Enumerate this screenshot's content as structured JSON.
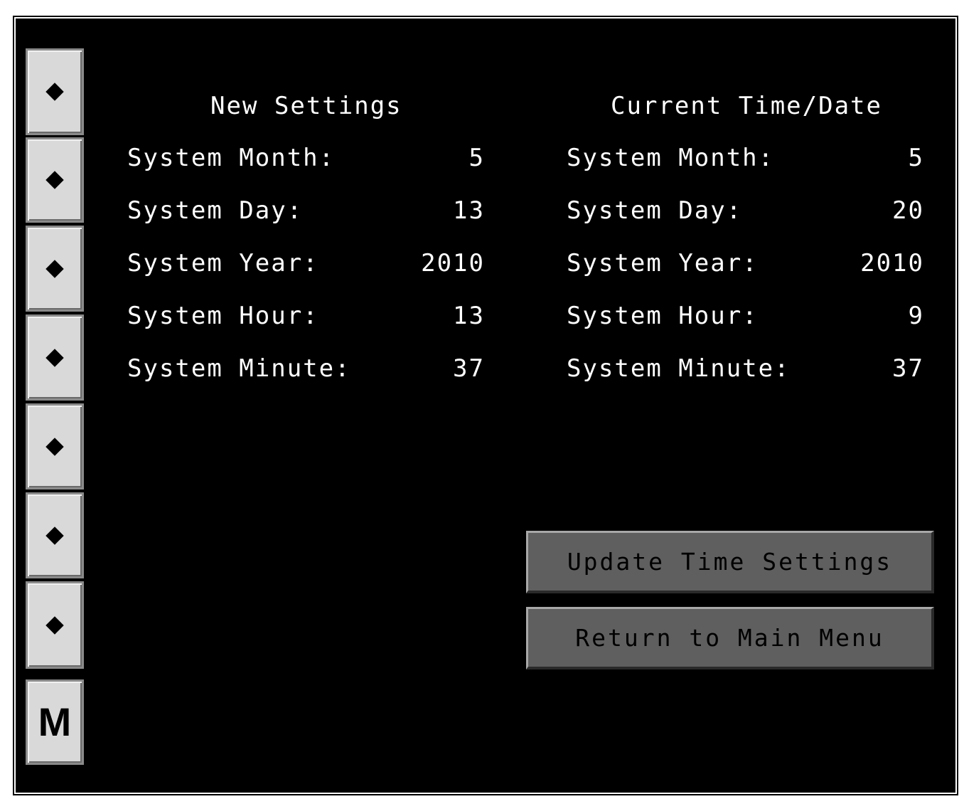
{
  "side_keys": {
    "menu_label": "M"
  },
  "new_settings": {
    "heading": "New Settings",
    "rows": [
      {
        "label": "System Month:",
        "value": "5"
      },
      {
        "label": "System Day:",
        "value": "13"
      },
      {
        "label": "System Year:",
        "value": "2010"
      },
      {
        "label": "System Hour:",
        "value": "13"
      },
      {
        "label": "System Minute:",
        "value": "37"
      }
    ]
  },
  "current": {
    "heading": "Current Time/Date",
    "rows": [
      {
        "label": "System Month:",
        "value": "5"
      },
      {
        "label": "System Day:",
        "value": "20"
      },
      {
        "label": "System Year:",
        "value": "2010"
      },
      {
        "label": "System Hour:",
        "value": "9"
      },
      {
        "label": "System Minute:",
        "value": "37"
      }
    ]
  },
  "buttons": {
    "update": "Update Time Settings",
    "return": "Return to Main Menu"
  },
  "colors": {
    "background": "#000000",
    "text": "#ffffff",
    "softkey": "#d9d9d9",
    "button": "#5f5f5f"
  },
  "icons": {
    "softkey_icon": "diamond-icon"
  }
}
